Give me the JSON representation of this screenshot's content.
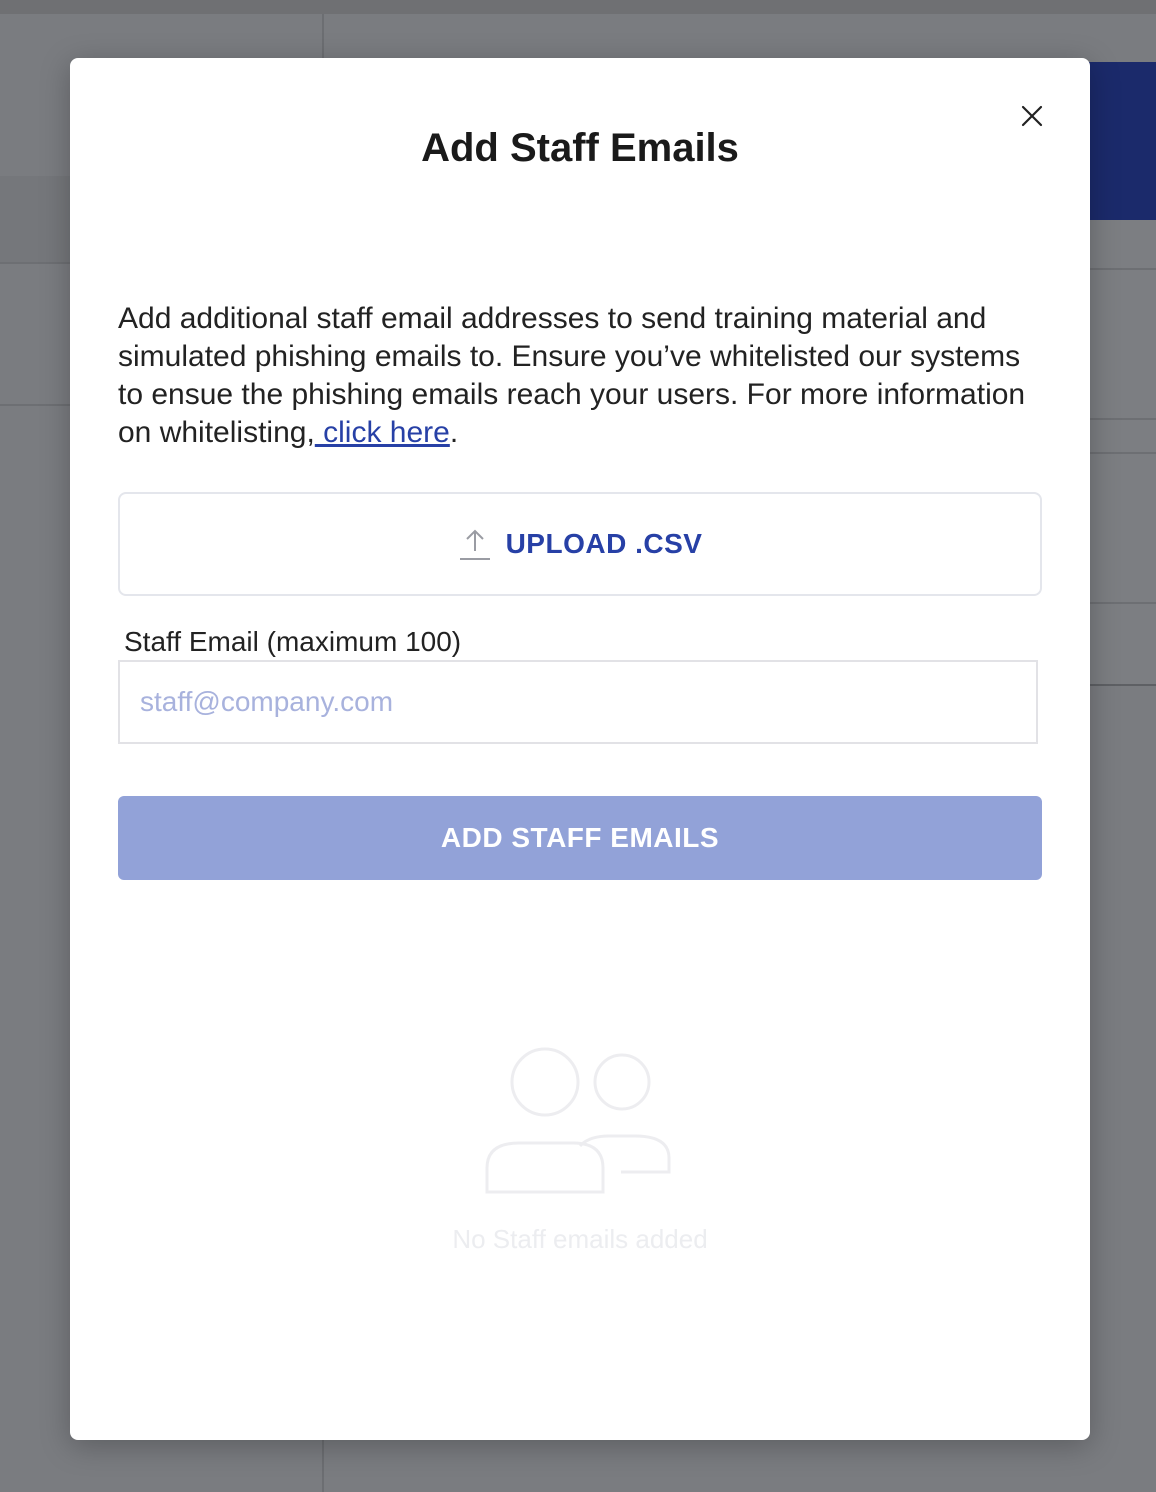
{
  "modal": {
    "title": "Add Staff Emails",
    "close_icon": "close-icon",
    "description": {
      "text": "Add additional staff email addresses to send training material and simulated phishing emails to. Ensure you’ve whitelisted our systems to ensue the phishing emails reach your users. For more information on whitelisting,",
      "link_text": " click here",
      "suffix": "."
    },
    "upload": {
      "icon": "upload-icon",
      "label": "UPLOAD .CSV"
    },
    "email_field": {
      "label": "Staff Email (maximum 100)",
      "value": "",
      "placeholder": "staff@company.com"
    },
    "add_button_label": "ADD STAFF EMAILS",
    "empty_state": {
      "icon": "users-icon",
      "text": "No Staff emails added"
    }
  },
  "colors": {
    "accent": "#2740a6",
    "button_disabled": "#92a2d8",
    "background_banner": "#1b2a6b"
  }
}
